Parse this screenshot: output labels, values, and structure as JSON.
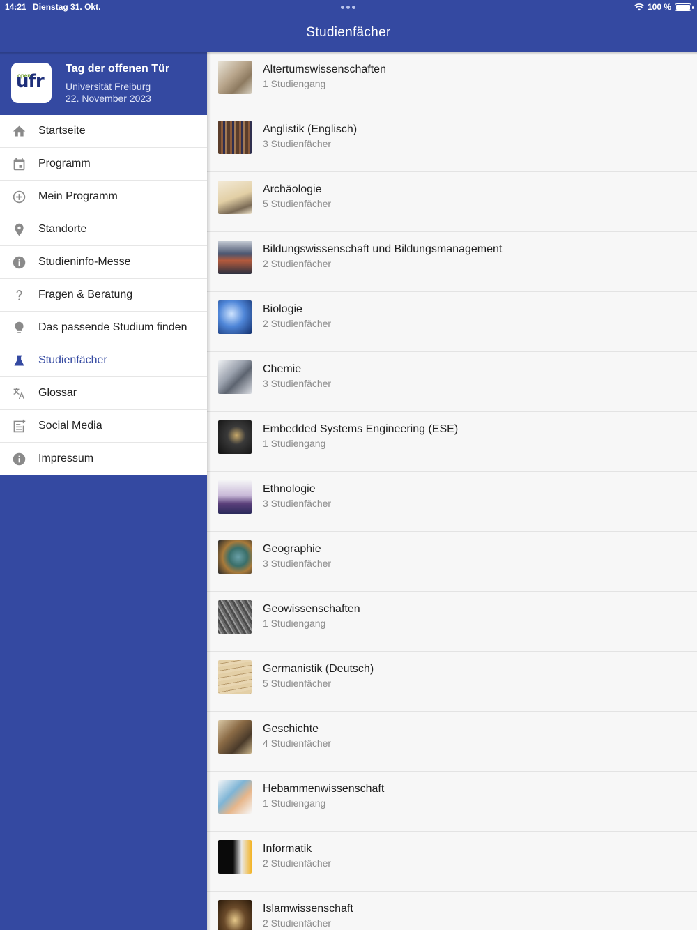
{
  "status": {
    "time": "14:21",
    "date": "Dienstag 31. Okt.",
    "battery": "100 %"
  },
  "header": {
    "title": "Studienfächer"
  },
  "sidebar": {
    "title": "Tag der offenen Tür",
    "subtitle_line1": "Universität Freiburg",
    "subtitle_line2": "22. November 2023",
    "logo_text": "ufr",
    "logo_small": "open",
    "items": [
      {
        "label": "Startseite",
        "icon": "home-icon"
      },
      {
        "label": "Programm",
        "icon": "calendar-icon"
      },
      {
        "label": "Mein Programm",
        "icon": "plus-circle-icon"
      },
      {
        "label": "Standorte",
        "icon": "map-pin-icon"
      },
      {
        "label": "Studieninfo-Messe",
        "icon": "info-icon"
      },
      {
        "label": "Fragen & Beratung",
        "icon": "question-icon"
      },
      {
        "label": "Das passende Studium finden",
        "icon": "lightbulb-icon"
      },
      {
        "label": "Studienfächer",
        "icon": "flask-icon",
        "active": true
      },
      {
        "label": "Glossar",
        "icon": "translate-icon"
      },
      {
        "label": "Social Media",
        "icon": "post-add-icon"
      },
      {
        "label": "Impressum",
        "icon": "info-icon"
      }
    ]
  },
  "subjects": [
    {
      "title": "Altertumswissenschaften",
      "sub": "1 Studiengang"
    },
    {
      "title": "Anglistik (Englisch)",
      "sub": "3 Studienfächer"
    },
    {
      "title": "Archäologie",
      "sub": "5 Studienfächer"
    },
    {
      "title": "Bildungswissenschaft und Bildungsmanagement",
      "sub": "2 Studienfächer"
    },
    {
      "title": "Biologie",
      "sub": "2 Studienfächer"
    },
    {
      "title": "Chemie",
      "sub": "3 Studienfächer"
    },
    {
      "title": "Embedded Systems Engineering (ESE)",
      "sub": "1 Studiengang"
    },
    {
      "title": "Ethnologie",
      "sub": "3 Studienfächer"
    },
    {
      "title": "Geographie",
      "sub": "3 Studienfächer"
    },
    {
      "title": "Geowissenschaften",
      "sub": "1 Studiengang"
    },
    {
      "title": "Germanistik (Deutsch)",
      "sub": "5 Studienfächer"
    },
    {
      "title": "Geschichte",
      "sub": "4 Studienfächer"
    },
    {
      "title": "Hebammenwissenschaft",
      "sub": "1 Studiengang"
    },
    {
      "title": "Informatik",
      "sub": "2 Studienfächer"
    },
    {
      "title": "Islamwissenschaft",
      "sub": "2 Studienfächer"
    }
  ],
  "colors": {
    "primary": "#3449a1",
    "active": "#3449a1",
    "icon": "#8a8a8a"
  }
}
